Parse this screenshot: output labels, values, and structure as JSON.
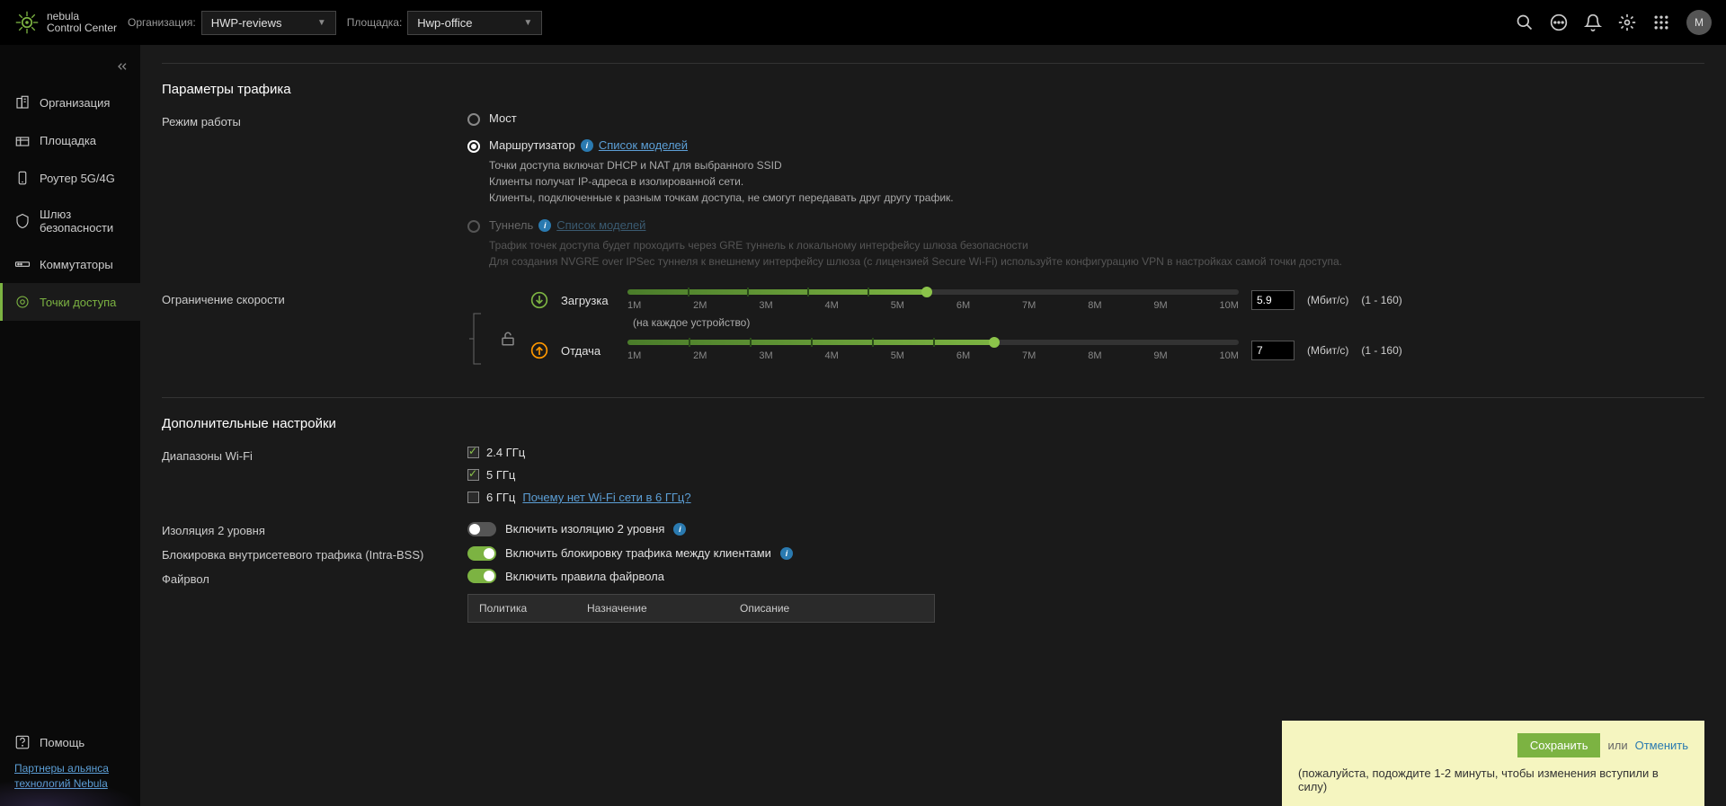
{
  "brand": {
    "line1": "nebula",
    "line2": "Control Center"
  },
  "topbar": {
    "org_label": "Организация:",
    "org_value": "HWP-reviews",
    "site_label": "Площадка:",
    "site_value": "Hwp-office",
    "avatar_initial": "M"
  },
  "sidebar": {
    "items": [
      {
        "label": "Организация"
      },
      {
        "label": "Площадка"
      },
      {
        "label": "Роутер 5G/4G"
      },
      {
        "label": "Шлюз безопасности"
      },
      {
        "label": "Коммутаторы"
      },
      {
        "label": "Точки доступа"
      }
    ],
    "help": "Помощь",
    "partner": "Партнеры альянса технологий Nebula"
  },
  "traffic": {
    "title": "Параметры трафика",
    "mode_label": "Режим работы",
    "opt_bridge": "Мост",
    "opt_router": "Маршрутизатор",
    "model_list": "Список моделей",
    "router_desc1": "Точки доступа включат DHCP и NAT для выбранного SSID",
    "router_desc2": "Клиенты получат IP-адреса в изолированной сети.",
    "router_desc3": "Клиенты, подключенные к разным точкам доступа, не смогут передавать друг другу трафик.",
    "opt_tunnel": "Туннель",
    "tunnel_desc1": "Трафик точек доступа будет проходить через GRE туннель к локальному интерфейсу шлюза безопасности",
    "tunnel_desc2": "Для создания NVGRE over IPSec туннеля к внешнему интерфейсу шлюза (с лицензией Secure Wi-Fi) используйте конфигурацию VPN в настройках самой точки доступа.",
    "rate_label": "Ограничение скорости",
    "download": "Загрузка",
    "upload": "Отдача",
    "per_device": "(на каждое устройство)",
    "dl_value": "5.9",
    "ul_value": "7",
    "unit": "(Мбит/с)",
    "range": "(1 - 160)",
    "ticks": [
      "1M",
      "2M",
      "3M",
      "4M",
      "5M",
      "6M",
      "7M",
      "8M",
      "9M",
      "10M"
    ],
    "dl_pct": 49,
    "ul_pct": 60
  },
  "advanced": {
    "title": "Дополнительные настройки",
    "bands_label": "Диапазоны Wi-Fi",
    "band24": "2.4 ГГц",
    "band5": "5 ГГц",
    "band6": "6 ГГц",
    "why6": "Почему нет Wi-Fi сети в 6 ГГц?",
    "l2iso_label": "Изоляция 2 уровня",
    "l2iso_text": "Включить изоляцию 2 уровня",
    "intrabss_label": "Блокировка внутрисетевого трафика (Intra-BSS)",
    "intrabss_text": "Включить блокировку трафика между клиентами",
    "fw_label": "Файрвол",
    "fw_text": "Включить правила файрвола",
    "fw_cols": {
      "policy": "Политика",
      "dest": "Назначение",
      "desc": "Описание"
    }
  },
  "banner": {
    "save": "Сохранить",
    "or": "или",
    "cancel": "Отменить",
    "note": "(пожалуйста, подождите 1-2 минуты, чтобы изменения вступили в силу)"
  }
}
